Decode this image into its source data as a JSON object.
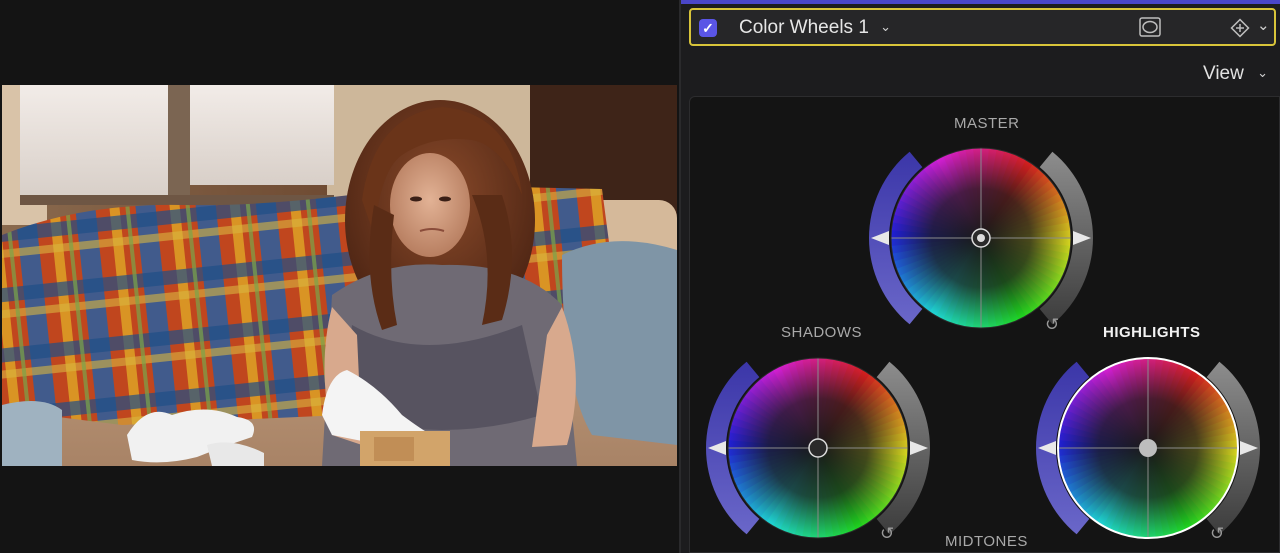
{
  "effect_header": {
    "enabled": true,
    "checkmark": "✓",
    "name": "Color Wheels 1",
    "name_chevron": "⌄",
    "mask_icon": "mask-icon",
    "keyframe_icon": "keyframe-icon",
    "collapse_chevron": "⌄"
  },
  "view_menu": {
    "label": "View",
    "chevron": "⌄"
  },
  "wheels": {
    "master": {
      "label": "MASTER",
      "active": false,
      "puck": "center",
      "reset": "↺"
    },
    "shadows": {
      "label": "SHADOWS",
      "active": false,
      "puck": "center",
      "reset": "↺"
    },
    "highlights": {
      "label": "HIGHLIGHTS",
      "active": true,
      "puck": "center",
      "reset": "↺"
    },
    "midtones": {
      "label": "MIDTONES"
    }
  },
  "colors": {
    "accent_blue": "#5a55e6",
    "selection_yellow": "#d8c43a",
    "panel_bg": "#141414"
  }
}
